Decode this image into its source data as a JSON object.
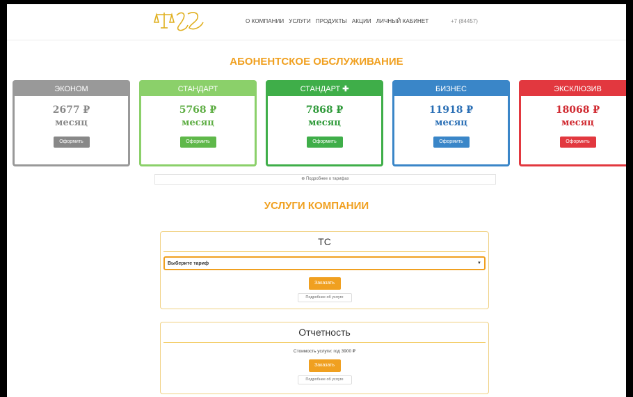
{
  "header": {
    "logo_text": "ДБ",
    "nav": [
      "О КОМПАНИИ",
      "УСЛУГИ",
      "ПРОДУКТЫ",
      "АКЦИИ",
      "ЛИЧНЫЙ КАБИНЕТ"
    ],
    "phone": "+7 (84457)"
  },
  "subscriptions": {
    "title": "АБОНЕНТСКОЕ ОБСЛУЖИВАНИЕ",
    "plans": [
      {
        "name": "ЭКОНОМ",
        "price": "2677 ₽",
        "period": "месяц",
        "button": "Оформить",
        "color": "#999999"
      },
      {
        "name": "СТАНДАРТ",
        "price": "5768 ₽",
        "period": "месяц",
        "button": "Оформить",
        "color": "#8bd06a"
      },
      {
        "name": "СТАНДАРТ",
        "price": "7868 ₽",
        "period": "месяц",
        "button": "Оформить",
        "color": "#3fae49",
        "plus": "✚"
      },
      {
        "name": "БИЗНЕС",
        "price": "11918 ₽",
        "period": "месяц",
        "button": "Оформить",
        "color": "#3a86c8"
      },
      {
        "name": "ЭКСКЛЮЗИВ",
        "price": "18068 ₽",
        "period": "месяц",
        "button": "Оформить",
        "color": "#e2383f"
      }
    ],
    "more_link": "⊕ Подробнее о тарифах"
  },
  "services": {
    "title": "УСЛУГИ КОМПАНИИ",
    "cards": [
      {
        "title": "ТС",
        "select_placeholder": "Выберите тариф",
        "order_button": "Заказать",
        "more_button": "Подробнее об услуге"
      },
      {
        "title": "Отчетность",
        "cost_text": "Стоимость услуги: год 3900 ₽",
        "order_button": "Заказать",
        "more_button": "Подробнее об услуге"
      }
    ]
  }
}
